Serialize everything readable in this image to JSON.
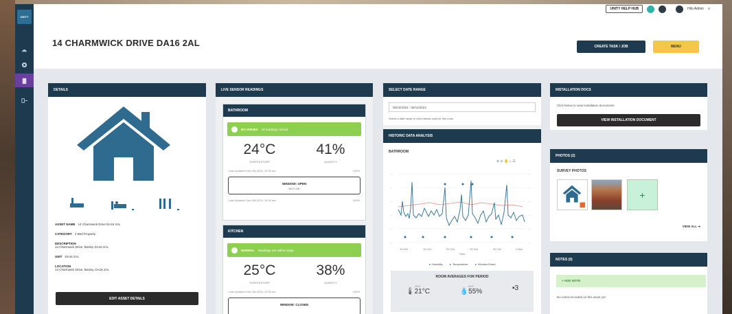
{
  "header": {
    "title": "14 CHARMWICK DRIVE DA16 2AL",
    "help_label": "UNITY HELP HUB",
    "user_label": "Hilo Admin",
    "create_button": "CREATE TASK / JOB",
    "yellow_button": "MENU"
  },
  "sidebar": {
    "logo": "UNITY"
  },
  "details": {
    "title": "DETAILS",
    "asset_name_label": "ASSET NAME",
    "asset_name": "14 Charmwick Drive DA16 2AL",
    "category_label": "CATEGORY",
    "category": "2 Bed Property",
    "description_label": "DESCRIPTION",
    "description": "14 Charmwick Drive, Bexley DA16 2AL",
    "unit_label": "UNIT",
    "unit": "DA16 2AL",
    "location_label": "LOCATION",
    "location": "14 Charmwick Drive, Bexley, DA16 2AL",
    "edit_button": "EDIT ASSET DETAILS"
  },
  "sensors": {
    "title": "LIVE SENSOR READINGS",
    "rooms": [
      {
        "name": "BATHROOM",
        "status": "NO ISSUES",
        "status_detail": "All readings normal",
        "temperature": "24°C",
        "temperature_label": "TEMPERATURE",
        "humidity": "41%",
        "humidity_label": "HUMIDITY",
        "updated": "Last Updated: Nov 5th 2024, 10:00 am",
        "signal": "100%",
        "window_label": "WINDOW: OPEN",
        "window_sub": "Wi-Fi OK",
        "updated2": "Last Updated: Nov 5th 2024, 10:00 am",
        "signal2": "100%"
      },
      {
        "name": "KITCHEN",
        "status": "NORMAL",
        "status_detail": "Readings are within range",
        "temperature": "25°C",
        "temperature_label": "TEMPERATURE",
        "humidity": "38%",
        "humidity_label": "HUMIDITY",
        "updated": "Last Updated: Nov 5th 2024, 10:00 am",
        "signal": "100%",
        "window_label": "WINDOW: CLOSED"
      }
    ]
  },
  "date_range": {
    "title": "SELECT DATE RANGE",
    "value": "05/10/2024 - 05/11/2024",
    "hint": "Select a date range to view historic data for this room"
  },
  "historic": {
    "title": "HISTORIC DATA ANALYSIS",
    "room": "BATHROOM",
    "x_ticks": [
      "10 Oct",
      "15 Oct",
      "20 Oct",
      "25 Oct",
      "30 Oct",
      "4 Nov"
    ],
    "x_title": "Time",
    "legend": [
      "Humidity",
      "Temperature",
      "Window Event"
    ],
    "averages_title": "ROOM AVERAGES FOR PERIOD",
    "avg_temp": "21°C",
    "avg_temp_label": "AVG",
    "avg_humidity": "55%",
    "avg_humidity_label": "AVG",
    "avg_events": "3",
    "avg_events_label": ""
  },
  "installation": {
    "title": "INSTALLATION DOCS",
    "text": "Click below to view installation documents",
    "button": "VIEW INSTALLATION DOCUMENT"
  },
  "photos": {
    "title": "PHOTOS (2)",
    "subtitle": "SURVEY PHOTOS",
    "view_all": "VIEW ALL"
  },
  "notes": {
    "title": "NOTES (0)",
    "add_label": "+ ADD NOTE",
    "empty_text": "No notes recorded on this asset yet"
  },
  "colors": {
    "navy": "#1d3a4e",
    "green": "#8dd04f",
    "yellow": "#f5c64a",
    "house_blue": "#2e6b8f"
  }
}
